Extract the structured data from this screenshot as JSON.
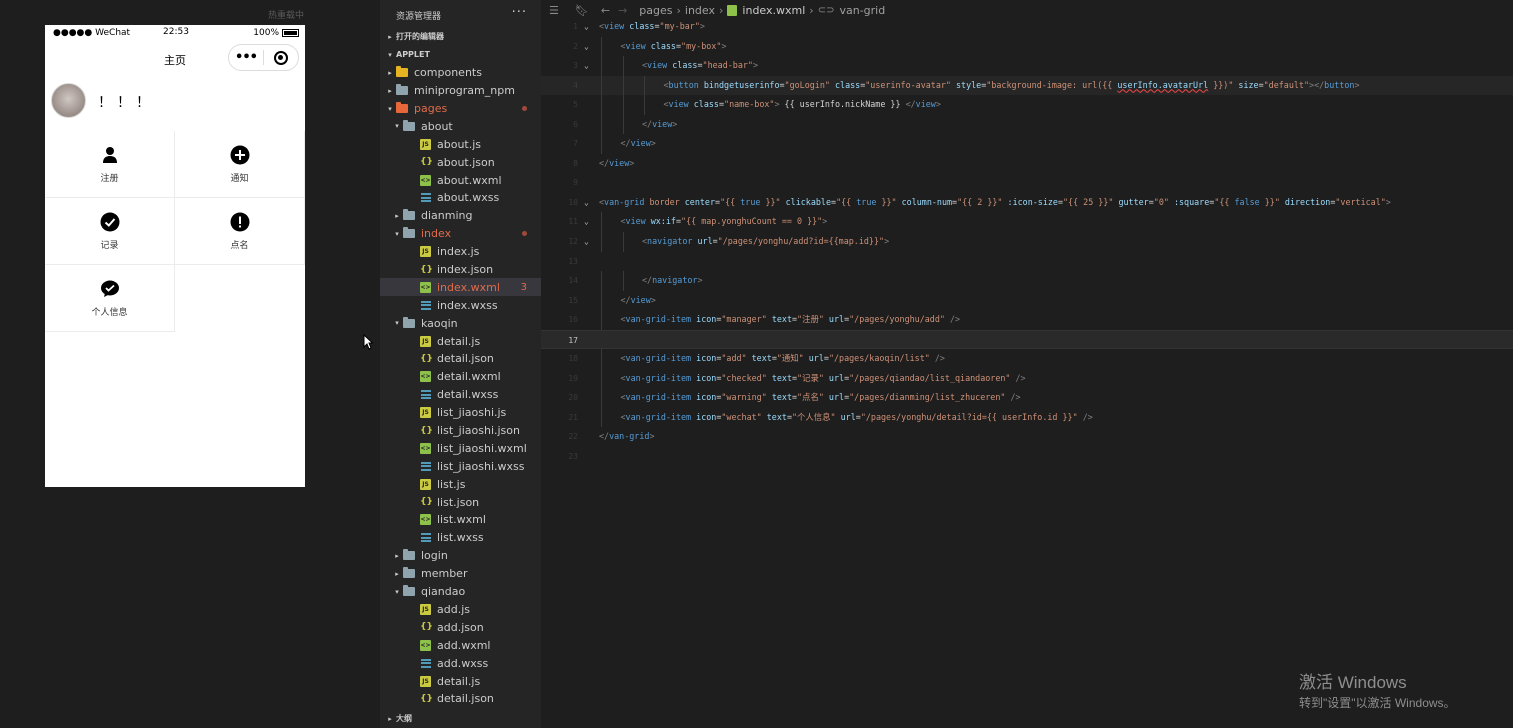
{
  "simulator": {
    "hot_reload": "热重载中",
    "status": {
      "carrier": "●●●●● WeChat",
      "time": "22:53",
      "battery": "100%"
    },
    "nav_title": "主页",
    "capsule_more": "•••",
    "user": {
      "nickname": "！！！"
    },
    "grid": [
      {
        "icon": "manager-icon",
        "text": "注册"
      },
      {
        "icon": "add-icon",
        "text": "通知"
      },
      {
        "icon": "checked-icon",
        "text": "记录"
      },
      {
        "icon": "warning-icon",
        "text": "点名"
      },
      {
        "icon": "wechat-icon",
        "text": "个人信息"
      }
    ]
  },
  "explorer": {
    "title": "资源管理器",
    "more": "···",
    "open_editors": "打开的编辑器",
    "root": "APPLET",
    "outline": "大纲",
    "items": [
      {
        "name": "components",
        "icon": "folder-yellow",
        "depth": 1,
        "chevron": "▸"
      },
      {
        "name": "miniprogram_npm",
        "icon": "folder",
        "depth": 1,
        "chevron": "▸"
      },
      {
        "name": "pages",
        "icon": "folder-red",
        "depth": 1,
        "chevron": "▾",
        "modified": true,
        "dot": true
      },
      {
        "name": "about",
        "icon": "folder-open",
        "depth": 2,
        "chevron": "▾"
      },
      {
        "name": "about.js",
        "icon": "js",
        "depth": 3
      },
      {
        "name": "about.json",
        "icon": "json",
        "depth": 3
      },
      {
        "name": "about.wxml",
        "icon": "wxml",
        "depth": 3
      },
      {
        "name": "about.wxss",
        "icon": "wxss",
        "depth": 3
      },
      {
        "name": "dianming",
        "icon": "folder",
        "depth": 2,
        "chevron": "▸"
      },
      {
        "name": "index",
        "icon": "folder-open",
        "depth": 2,
        "chevron": "▾",
        "modified": true,
        "dot": true
      },
      {
        "name": "index.js",
        "icon": "js",
        "depth": 3
      },
      {
        "name": "index.json",
        "icon": "json",
        "depth": 3
      },
      {
        "name": "index.wxml",
        "icon": "wxml",
        "depth": 3,
        "modified": true,
        "active": true,
        "badge": "3"
      },
      {
        "name": "index.wxss",
        "icon": "wxss",
        "depth": 3
      },
      {
        "name": "kaoqin",
        "icon": "folder-open",
        "depth": 2,
        "chevron": "▾"
      },
      {
        "name": "detail.js",
        "icon": "js",
        "depth": 3
      },
      {
        "name": "detail.json",
        "icon": "json",
        "depth": 3
      },
      {
        "name": "detail.wxml",
        "icon": "wxml",
        "depth": 3
      },
      {
        "name": "detail.wxss",
        "icon": "wxss",
        "depth": 3
      },
      {
        "name": "list_jiaoshi.js",
        "icon": "js",
        "depth": 3
      },
      {
        "name": "list_jiaoshi.json",
        "icon": "json",
        "depth": 3
      },
      {
        "name": "list_jiaoshi.wxml",
        "icon": "wxml",
        "depth": 3
      },
      {
        "name": "list_jiaoshi.wxss",
        "icon": "wxss",
        "depth": 3
      },
      {
        "name": "list.js",
        "icon": "js",
        "depth": 3
      },
      {
        "name": "list.json",
        "icon": "json",
        "depth": 3
      },
      {
        "name": "list.wxml",
        "icon": "wxml",
        "depth": 3
      },
      {
        "name": "list.wxss",
        "icon": "wxss",
        "depth": 3
      },
      {
        "name": "login",
        "icon": "folder",
        "depth": 2,
        "chevron": "▸"
      },
      {
        "name": "member",
        "icon": "folder",
        "depth": 2,
        "chevron": "▸"
      },
      {
        "name": "qiandao",
        "icon": "folder-open",
        "depth": 2,
        "chevron": "▾"
      },
      {
        "name": "add.js",
        "icon": "js",
        "depth": 3
      },
      {
        "name": "add.json",
        "icon": "json",
        "depth": 3
      },
      {
        "name": "add.wxml",
        "icon": "wxml",
        "depth": 3
      },
      {
        "name": "add.wxss",
        "icon": "wxss",
        "depth": 3
      },
      {
        "name": "detail.js",
        "icon": "js",
        "depth": 3
      },
      {
        "name": "detail.json",
        "icon": "json",
        "depth": 3
      }
    ]
  },
  "editor": {
    "breadcrumb": [
      "pages",
      "index",
      "index.wxml",
      "van-grid"
    ],
    "current_line": "17",
    "lines": [
      {
        "n": "1",
        "fold": "⌄",
        "indent": 0,
        "code": [
          [
            "p",
            "<"
          ],
          [
            "t",
            "view"
          ],
          [
            "x",
            " "
          ],
          [
            "a",
            "class"
          ],
          [
            "x",
            "="
          ],
          [
            "s",
            "\"my-bar\""
          ],
          [
            "p",
            ">"
          ]
        ]
      },
      {
        "n": "2",
        "fold": "⌄",
        "indent": 1,
        "code": [
          [
            "p",
            "<"
          ],
          [
            "t",
            "view"
          ],
          [
            "x",
            " "
          ],
          [
            "a",
            "class"
          ],
          [
            "x",
            "="
          ],
          [
            "s",
            "\"my-box\""
          ],
          [
            "p",
            ">"
          ]
        ]
      },
      {
        "n": "3",
        "fold": "⌄",
        "indent": 2,
        "code": [
          [
            "p",
            "<"
          ],
          [
            "t",
            "view"
          ],
          [
            "x",
            " "
          ],
          [
            "a",
            "class"
          ],
          [
            "x",
            "="
          ],
          [
            "s",
            "\"head-bar\""
          ],
          [
            "p",
            ">"
          ]
        ]
      },
      {
        "n": "4",
        "indent": 3,
        "hl": true,
        "code": [
          [
            "p",
            "<"
          ],
          [
            "t",
            "button"
          ],
          [
            "x",
            " "
          ],
          [
            "a",
            "bindgetuserinfo"
          ],
          [
            "x",
            "="
          ],
          [
            "s",
            "\"goLogin\""
          ],
          [
            "x",
            " "
          ],
          [
            "a",
            "class"
          ],
          [
            "x",
            "="
          ],
          [
            "s",
            "\"userinfo-avatar\""
          ],
          [
            "x",
            " "
          ],
          [
            "a",
            "style"
          ],
          [
            "x",
            "="
          ],
          [
            "s",
            "\"background-image: url({{ "
          ],
          [
            "sq",
            "userInfo.avatarUrl"
          ],
          [
            "s",
            " }})\""
          ],
          [
            "x",
            " "
          ],
          [
            "a",
            "size"
          ],
          [
            "x",
            "="
          ],
          [
            "s",
            "\"default\""
          ],
          [
            "p",
            "></"
          ],
          [
            "t",
            "button"
          ],
          [
            "p",
            ">"
          ]
        ]
      },
      {
        "n": "5",
        "indent": 3,
        "code": [
          [
            "p",
            "<"
          ],
          [
            "t",
            "view"
          ],
          [
            "x",
            " "
          ],
          [
            "a",
            "class"
          ],
          [
            "x",
            "="
          ],
          [
            "s",
            "\"name-box\""
          ],
          [
            "p",
            ">"
          ],
          [
            "x",
            " {{ userInfo.nickName }} "
          ],
          [
            "p",
            "</"
          ],
          [
            "t",
            "view"
          ],
          [
            "p",
            ">"
          ]
        ]
      },
      {
        "n": "6",
        "indent": 2,
        "code": [
          [
            "p",
            "</"
          ],
          [
            "t",
            "view"
          ],
          [
            "p",
            ">"
          ]
        ]
      },
      {
        "n": "7",
        "indent": 1,
        "code": [
          [
            "p",
            "</"
          ],
          [
            "t",
            "view"
          ],
          [
            "p",
            ">"
          ]
        ]
      },
      {
        "n": "8",
        "indent": 0,
        "code": [
          [
            "p",
            "</"
          ],
          [
            "t",
            "view"
          ],
          [
            "p",
            ">"
          ]
        ]
      },
      {
        "n": "9",
        "indent": 0,
        "code": []
      },
      {
        "n": "10",
        "fold": "⌄",
        "indent": 0,
        "code": [
          [
            "p",
            "<"
          ],
          [
            "t",
            "van-grid"
          ],
          [
            "x",
            " "
          ],
          [
            "s",
            "border"
          ],
          [
            "x",
            " "
          ],
          [
            "a",
            "center"
          ],
          [
            "x",
            "="
          ],
          [
            "s",
            "\"{{ "
          ],
          [
            "t",
            "true"
          ],
          [
            "s",
            " }}\""
          ],
          [
            "x",
            " "
          ],
          [
            "a",
            "clickable"
          ],
          [
            "x",
            "="
          ],
          [
            "s",
            "\"{{ "
          ],
          [
            "t",
            "true"
          ],
          [
            "s",
            " }}\""
          ],
          [
            "x",
            " "
          ],
          [
            "a",
            "column-num"
          ],
          [
            "x",
            "="
          ],
          [
            "s",
            "\"{{ 2 }}\""
          ],
          [
            "x",
            " "
          ],
          [
            "a",
            ":icon-size"
          ],
          [
            "x",
            "="
          ],
          [
            "s",
            "\"{{ 25 }}\""
          ],
          [
            "x",
            " "
          ],
          [
            "a",
            "gutter"
          ],
          [
            "x",
            "="
          ],
          [
            "s",
            "\"0\""
          ],
          [
            "x",
            " "
          ],
          [
            "a",
            ":square"
          ],
          [
            "x",
            "="
          ],
          [
            "s",
            "\"{{ "
          ],
          [
            "t",
            "false"
          ],
          [
            "s",
            " }}\""
          ],
          [
            "x",
            " "
          ],
          [
            "a",
            "direction"
          ],
          [
            "x",
            "="
          ],
          [
            "s",
            "\"vertical\""
          ],
          [
            "p",
            ">"
          ]
        ]
      },
      {
        "n": "11",
        "fold": "⌄",
        "indent": 1,
        "code": [
          [
            "p",
            "<"
          ],
          [
            "t",
            "view"
          ],
          [
            "x",
            " "
          ],
          [
            "a",
            "wx:if"
          ],
          [
            "x",
            "="
          ],
          [
            "s",
            "\"{{ map.yonghuCount == 0 }}\""
          ],
          [
            "p",
            ">"
          ]
        ]
      },
      {
        "n": "12",
        "fold": "⌄",
        "indent": 2,
        "code": [
          [
            "p",
            "<"
          ],
          [
            "t",
            "navigator"
          ],
          [
            "x",
            " "
          ],
          [
            "a",
            "url"
          ],
          [
            "x",
            "="
          ],
          [
            "s",
            "\"/pages/yonghu/add?id={{map.id}}\""
          ],
          [
            "p",
            ">"
          ]
        ]
      },
      {
        "n": "13",
        "indent": 0,
        "code": []
      },
      {
        "n": "14",
        "indent": 2,
        "code": [
          [
            "p",
            "</"
          ],
          [
            "t",
            "navigator"
          ],
          [
            "p",
            ">"
          ]
        ]
      },
      {
        "n": "15",
        "indent": 1,
        "code": [
          [
            "p",
            "</"
          ],
          [
            "t",
            "view"
          ],
          [
            "p",
            ">"
          ]
        ]
      },
      {
        "n": "16",
        "indent": 1,
        "code": [
          [
            "p",
            "<"
          ],
          [
            "t",
            "van-grid-item"
          ],
          [
            "x",
            " "
          ],
          [
            "a",
            "icon"
          ],
          [
            "x",
            "="
          ],
          [
            "s",
            "\"manager\""
          ],
          [
            "x",
            " "
          ],
          [
            "a",
            "text"
          ],
          [
            "x",
            "="
          ],
          [
            "s",
            "\"注册\""
          ],
          [
            "x",
            " "
          ],
          [
            "a",
            "url"
          ],
          [
            "x",
            "="
          ],
          [
            "s",
            "\"/pages/yonghu/add\""
          ],
          [
            "x",
            " "
          ],
          [
            "p",
            "/>"
          ]
        ]
      },
      {
        "n": "17",
        "indent": 0,
        "current": true,
        "code": []
      },
      {
        "n": "18",
        "indent": 1,
        "code": [
          [
            "p",
            "<"
          ],
          [
            "t",
            "van-grid-item"
          ],
          [
            "x",
            " "
          ],
          [
            "a",
            "icon"
          ],
          [
            "x",
            "="
          ],
          [
            "s",
            "\"add\""
          ],
          [
            "x",
            " "
          ],
          [
            "a",
            "text"
          ],
          [
            "x",
            "="
          ],
          [
            "s",
            "\"通知\""
          ],
          [
            "x",
            " "
          ],
          [
            "a",
            "url"
          ],
          [
            "x",
            "="
          ],
          [
            "s",
            "\"/pages/kaoqin/list\""
          ],
          [
            "x",
            " "
          ],
          [
            "p",
            "/>"
          ]
        ]
      },
      {
        "n": "19",
        "indent": 1,
        "code": [
          [
            "p",
            "<"
          ],
          [
            "t",
            "van-grid-item"
          ],
          [
            "x",
            " "
          ],
          [
            "a",
            "icon"
          ],
          [
            "x",
            "="
          ],
          [
            "s",
            "\"checked\""
          ],
          [
            "x",
            " "
          ],
          [
            "a",
            "text"
          ],
          [
            "x",
            "="
          ],
          [
            "s",
            "\"记录\""
          ],
          [
            "x",
            " "
          ],
          [
            "a",
            "url"
          ],
          [
            "x",
            "="
          ],
          [
            "s",
            "\"/pages/qiandao/list_qiandaoren\""
          ],
          [
            "x",
            " "
          ],
          [
            "p",
            "/>"
          ]
        ]
      },
      {
        "n": "20",
        "indent": 1,
        "code": [
          [
            "p",
            "<"
          ],
          [
            "t",
            "van-grid-item"
          ],
          [
            "x",
            " "
          ],
          [
            "a",
            "icon"
          ],
          [
            "x",
            "="
          ],
          [
            "s",
            "\"warning\""
          ],
          [
            "x",
            " "
          ],
          [
            "a",
            "text"
          ],
          [
            "x",
            "="
          ],
          [
            "s",
            "\"点名\""
          ],
          [
            "x",
            " "
          ],
          [
            "a",
            "url"
          ],
          [
            "x",
            "="
          ],
          [
            "s",
            "\"/pages/dianming/list_zhuceren\""
          ],
          [
            "x",
            " "
          ],
          [
            "p",
            "/>"
          ]
        ]
      },
      {
        "n": "21",
        "indent": 1,
        "code": [
          [
            "p",
            "<"
          ],
          [
            "t",
            "van-grid-item"
          ],
          [
            "x",
            " "
          ],
          [
            "a",
            "icon"
          ],
          [
            "x",
            "="
          ],
          [
            "s",
            "\"wechat\""
          ],
          [
            "x",
            " "
          ],
          [
            "a",
            "text"
          ],
          [
            "x",
            "="
          ],
          [
            "s",
            "\"个人信息\""
          ],
          [
            "x",
            " "
          ],
          [
            "a",
            "url"
          ],
          [
            "x",
            "="
          ],
          [
            "s",
            "\"/pages/yonghu/detail?id={{ userInfo.id }}\""
          ],
          [
            "x",
            " "
          ],
          [
            "p",
            "/>"
          ]
        ]
      },
      {
        "n": "22",
        "indent": 0,
        "code": [
          [
            "p",
            "</"
          ],
          [
            "t",
            "van-grid"
          ],
          [
            "p",
            ">"
          ]
        ]
      },
      {
        "n": "23",
        "indent": 0,
        "code": []
      }
    ]
  },
  "watermark": {
    "title": "激活 Windows",
    "subtitle": "转到\"设置\"以激活 Windows。"
  }
}
